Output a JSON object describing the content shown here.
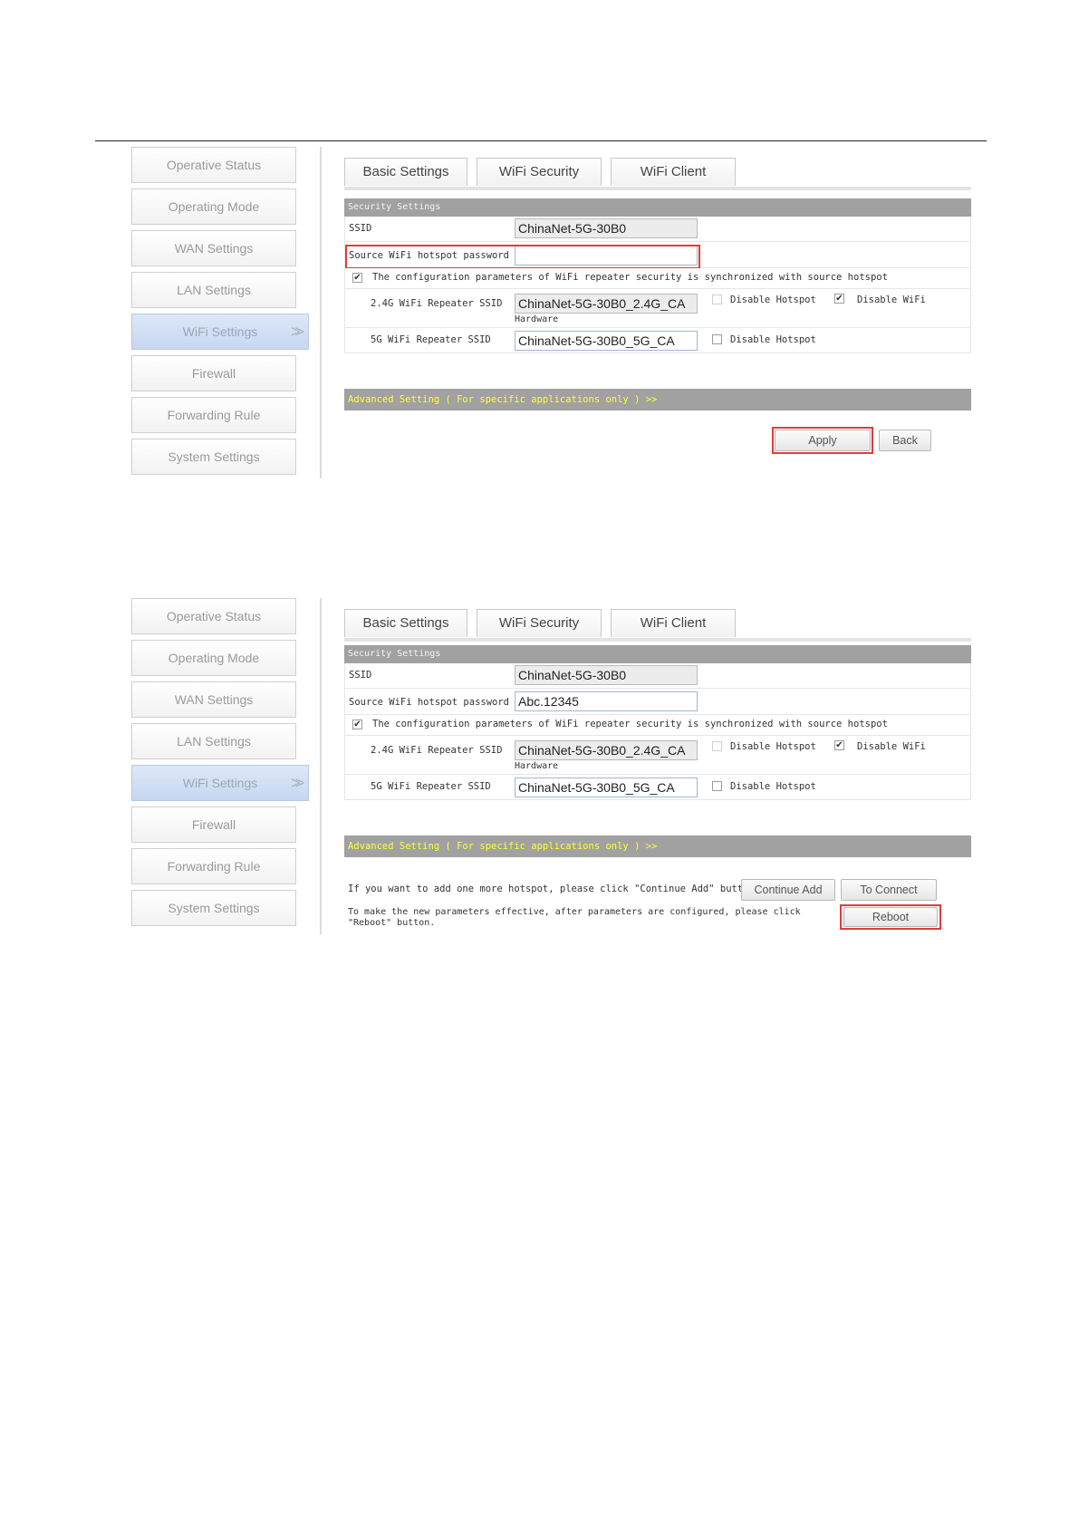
{
  "sidebar": {
    "items": [
      {
        "label": "Operative Status"
      },
      {
        "label": "Operating Mode"
      },
      {
        "label": "WAN Settings"
      },
      {
        "label": "LAN Settings"
      },
      {
        "label": "WiFi Settings",
        "active": true,
        "arrow": ">>"
      },
      {
        "label": "Firewall"
      },
      {
        "label": "Forwarding Rule"
      },
      {
        "label": "System Settings"
      }
    ]
  },
  "tabs": [
    "Basic Settings",
    "WiFi Security",
    "WiFi Client"
  ],
  "section_title": "Security Settings",
  "fields": {
    "ssid_label": "SSID",
    "ssid_value": "ChinaNet-5G-30B0",
    "password_label": "Source WiFi hotspot password",
    "sync_text": "The configuration parameters of WiFi repeater security is synchronized with source hotspot",
    "ssid24_label": "2.4G WiFi Repeater SSID",
    "ssid24_value": "ChinaNet-5G-30B0_2.4G_CA",
    "hardware_text": "Hardware",
    "ssid5_label": "5G WiFi Repeater SSID",
    "ssid5_value": "ChinaNet-5G-30B0_5G_CA",
    "disable_hotspot": "Disable Hotspot",
    "disable_wifi": "Disable WiFi"
  },
  "advanced_text": "Advanced Setting ( For specific applications only ) >>",
  "screen1": {
    "password_value": "",
    "apply_label": "Apply",
    "back_label": "Back"
  },
  "screen2": {
    "password_value": "Abc.12345",
    "continue_text": "If you want to add one more hotspot, please click \"Continue Add\" button.",
    "continue_add_label": "Continue Add",
    "to_connect_label": "To Connect",
    "reboot_text_1": "To make the new parameters effective, after parameters are configured, please click",
    "reboot_text_2": "\"Reboot\" button.",
    "reboot_label": "Reboot"
  },
  "colors": {
    "highlight": "#e23b3b",
    "advanced_text": "#ffff33",
    "section_header": "#a1a1a1"
  }
}
